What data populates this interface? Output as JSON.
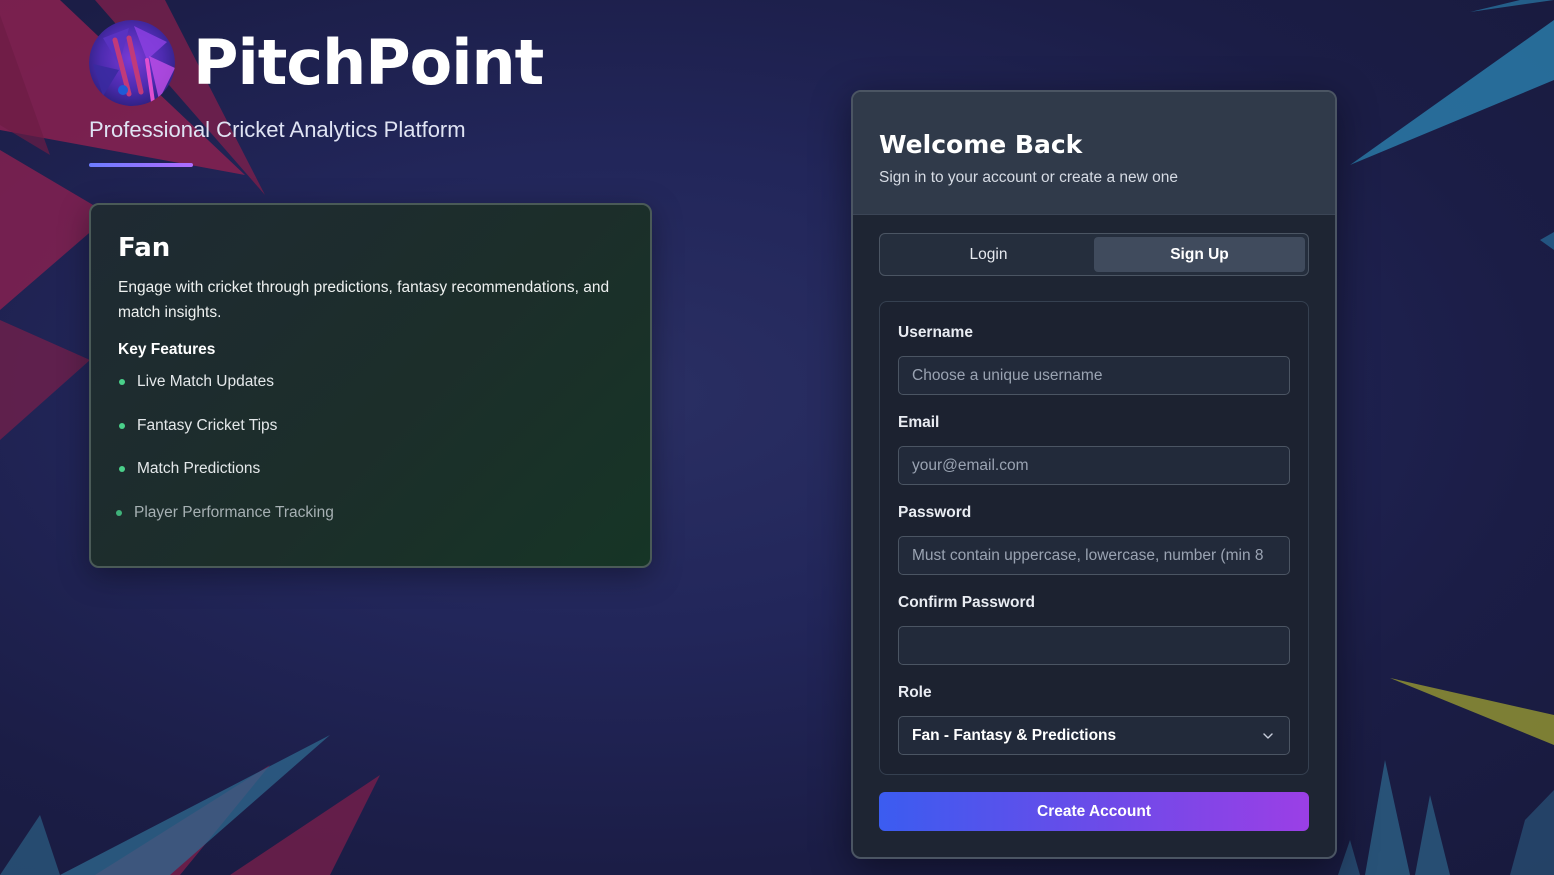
{
  "brand": {
    "name": "PitchPoint",
    "tagline": "Professional Cricket Analytics Platform"
  },
  "role_card": {
    "title": "Fan",
    "description": "Engage with cricket through predictions, fantasy recommendations, and match insights.",
    "features_title": "Key Features",
    "features": [
      "Live Match Updates",
      "Fantasy Cricket Tips",
      "Match Predictions",
      "Player Performance Tracking"
    ]
  },
  "auth": {
    "title": "Welcome Back",
    "subtitle": "Sign in to your account or create a new one",
    "tabs": [
      {
        "label": "Login",
        "active": false
      },
      {
        "label": "Sign Up",
        "active": true
      }
    ],
    "fields": {
      "username": {
        "label": "Username",
        "placeholder": "Choose a unique username",
        "value": ""
      },
      "email": {
        "label": "Email",
        "placeholder": "your@email.com",
        "value": ""
      },
      "password": {
        "label": "Password",
        "placeholder": "Must contain uppercase, lowercase, number (min 8",
        "value": ""
      },
      "confirm_password": {
        "label": "Confirm Password",
        "placeholder": "",
        "value": ""
      },
      "role": {
        "label": "Role",
        "selected": "Fan - Fantasy & Predictions"
      }
    },
    "submit_label": "Create Account"
  },
  "colors": {
    "accent_start": "#3b5cf0",
    "accent_end": "#9b3fe6",
    "feature_dot": "#4ad08a",
    "background": "#1c1f44"
  },
  "icons": {
    "logo": "cricket-logo-icon",
    "select": "chevron-down-icon",
    "bullet": "bullet-dot-icon"
  }
}
